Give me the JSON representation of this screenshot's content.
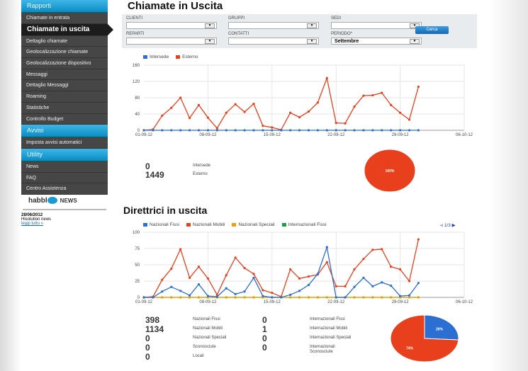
{
  "sidebar": {
    "sections": [
      {
        "title": "Rapporti",
        "items": [
          "Chiamate in entrata",
          "Chiamate in uscita",
          "Dettaglio chiamate",
          "Geolocalizzazione chiamate",
          "Geolocalizzazione dispositivo",
          "Messaggi",
          "Dettaglio Messaggi",
          "Roaming",
          "Statistiche",
          "Controllo Budget"
        ],
        "active": 1
      },
      {
        "title": "Avvisi",
        "items": [
          "Imposta avvisi automatici"
        ]
      },
      {
        "title": "Utility",
        "items": [
          "News",
          "FAQ",
          "Centro Assistenza"
        ]
      }
    ]
  },
  "news": {
    "logo": "habble NEWS",
    "date": "28/06/2012",
    "text": "Hisolution news",
    "link": "leggi tutto »"
  },
  "page_title": "Chiamate in Uscita",
  "filters": {
    "clienti": "CLIENTI",
    "gruppi": "GRUPPI",
    "sedi": "SEDI",
    "reparti": "REPARTI",
    "contatti": "CONTATTI",
    "periodo": "PERIODO*",
    "periodo_value": "Settembre",
    "search": "Cerca"
  },
  "section2_title": "Direttrici in uscita",
  "colors": {
    "blue": "#2a6fd1",
    "red": "#e8401c",
    "orange": "#f59c00",
    "green": "#18a23a",
    "accent": "#0a8cc4"
  },
  "chart_data": [
    {
      "type": "line",
      "x_ticks": [
        "01-09-12",
        "08-09-12",
        "15-09-12",
        "22-09-12",
        "29-09-12",
        "06-10-12"
      ],
      "ylim": [
        0,
        160
      ],
      "y_ticks": [
        0,
        40,
        80,
        120,
        160
      ],
      "grid": true,
      "legend": "top-left",
      "series": [
        {
          "name": "Intersede",
          "color": "#2a6fd1",
          "values": [
            0,
            0,
            0,
            0,
            0,
            0,
            0,
            0,
            0,
            0,
            0,
            0,
            0,
            0,
            0,
            0,
            0,
            0,
            0,
            0,
            0,
            0,
            0,
            0,
            0,
            0,
            0,
            0,
            0,
            0,
            0
          ]
        },
        {
          "name": "Esterno",
          "color": "#e8401c",
          "values": [
            0,
            2,
            36,
            55,
            80,
            30,
            62,
            31,
            5,
            43,
            64,
            45,
            65,
            11,
            7,
            1,
            43,
            32,
            46,
            68,
            128,
            18,
            17,
            58,
            85,
            86,
            92,
            62,
            43,
            26,
            107
          ]
        }
      ]
    },
    {
      "type": "pie",
      "slices": [
        {
          "label": "100%",
          "value": 100,
          "color": "#e8401c"
        }
      ]
    },
    {
      "type": "line",
      "x_ticks": [
        "01-09-12",
        "08-09-12",
        "15-09-12",
        "22-09-12",
        "29-09-12",
        "06-10-12"
      ],
      "ylim": [
        0,
        100
      ],
      "y_ticks": [
        0,
        25,
        50,
        75,
        100
      ],
      "grid": true,
      "legend": "top-left",
      "pager": "1/3",
      "series": [
        {
          "name": "Nazionali Fissi",
          "color": "#2a6fd1",
          "values": [
            0,
            0,
            9,
            16,
            10,
            3,
            20,
            2,
            1,
            14,
            5,
            9,
            30,
            2,
            0,
            0,
            4,
            10,
            19,
            36,
            77,
            0,
            0,
            16,
            30,
            17,
            23,
            18,
            2,
            3,
            22
          ]
        },
        {
          "name": "Nazionali Mobili",
          "color": "#e8401c",
          "values": [
            0,
            1,
            27,
            44,
            74,
            30,
            47,
            29,
            4,
            34,
            61,
            45,
            36,
            11,
            7,
            1,
            43,
            29,
            32,
            35,
            54,
            17,
            17,
            43,
            59,
            73,
            74,
            47,
            43,
            25,
            89
          ]
        },
        {
          "name": "Nazionali Speciali",
          "color": "#f59c00",
          "values": [
            0,
            0,
            0,
            0,
            0,
            0,
            0,
            0,
            0,
            0,
            0,
            0,
            0,
            0,
            0,
            0,
            0,
            0,
            0,
            0,
            0,
            0,
            0,
            0,
            0,
            0,
            0,
            0,
            0,
            0,
            0
          ]
        },
        {
          "name": "Internazionali Fissi",
          "color": "#18a23a",
          "values": [
            0,
            0,
            0,
            0,
            0,
            0,
            0,
            0,
            0,
            0,
            0,
            0,
            0,
            0,
            0,
            0,
            0,
            0,
            0,
            0,
            0,
            0,
            0,
            0,
            0,
            0,
            0,
            0,
            0,
            0,
            0
          ]
        }
      ]
    },
    {
      "type": "pie",
      "slices": [
        {
          "label": "26%",
          "value": 26,
          "color": "#2a6fd1"
        },
        {
          "label": "74%",
          "value": 74,
          "color": "#e8401c"
        }
      ]
    }
  ],
  "stats1": [
    {
      "value": "0",
      "label": "Intersede"
    },
    {
      "value": "1449",
      "label": "Esterno"
    }
  ],
  "stats2_left": [
    {
      "value": "398",
      "label": "Nazionali Fissi"
    },
    {
      "value": "1134",
      "label": "Nazionali Mobili"
    },
    {
      "value": "0",
      "label": "Nazionali Speciali"
    },
    {
      "value": "0",
      "label": "Sconosciute"
    },
    {
      "value": "0",
      "label": "Locali"
    }
  ],
  "stats2_right": [
    {
      "value": "0",
      "label": "Internazionali Fissi"
    },
    {
      "value": "1",
      "label": "Internazionali Mobili"
    },
    {
      "value": "0",
      "label": "Internazionali Speciali"
    },
    {
      "value": "0",
      "label": "Internazionali Sconosciute"
    }
  ]
}
